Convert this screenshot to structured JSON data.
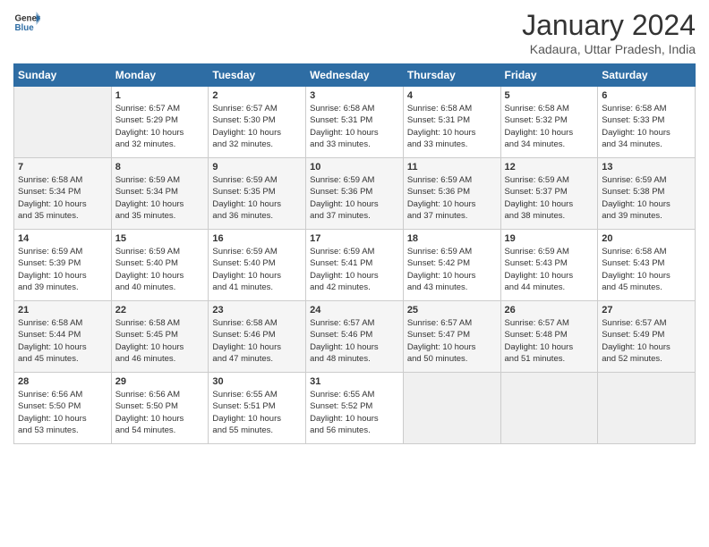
{
  "header": {
    "logo_line1": "General",
    "logo_line2": "Blue",
    "month_title": "January 2024",
    "location": "Kadaura, Uttar Pradesh, India"
  },
  "days_of_week": [
    "Sunday",
    "Monday",
    "Tuesday",
    "Wednesday",
    "Thursday",
    "Friday",
    "Saturday"
  ],
  "weeks": [
    [
      {
        "day": "",
        "empty": true
      },
      {
        "day": "1",
        "sunrise": "6:57 AM",
        "sunset": "5:29 PM",
        "daylight": "10 hours and 32 minutes."
      },
      {
        "day": "2",
        "sunrise": "6:57 AM",
        "sunset": "5:30 PM",
        "daylight": "10 hours and 32 minutes."
      },
      {
        "day": "3",
        "sunrise": "6:58 AM",
        "sunset": "5:31 PM",
        "daylight": "10 hours and 33 minutes."
      },
      {
        "day": "4",
        "sunrise": "6:58 AM",
        "sunset": "5:31 PM",
        "daylight": "10 hours and 33 minutes."
      },
      {
        "day": "5",
        "sunrise": "6:58 AM",
        "sunset": "5:32 PM",
        "daylight": "10 hours and 34 minutes."
      },
      {
        "day": "6",
        "sunrise": "6:58 AM",
        "sunset": "5:33 PM",
        "daylight": "10 hours and 34 minutes."
      }
    ],
    [
      {
        "day": "7",
        "sunrise": "6:58 AM",
        "sunset": "5:34 PM",
        "daylight": "10 hours and 35 minutes."
      },
      {
        "day": "8",
        "sunrise": "6:59 AM",
        "sunset": "5:34 PM",
        "daylight": "10 hours and 35 minutes."
      },
      {
        "day": "9",
        "sunrise": "6:59 AM",
        "sunset": "5:35 PM",
        "daylight": "10 hours and 36 minutes."
      },
      {
        "day": "10",
        "sunrise": "6:59 AM",
        "sunset": "5:36 PM",
        "daylight": "10 hours and 37 minutes."
      },
      {
        "day": "11",
        "sunrise": "6:59 AM",
        "sunset": "5:36 PM",
        "daylight": "10 hours and 37 minutes."
      },
      {
        "day": "12",
        "sunrise": "6:59 AM",
        "sunset": "5:37 PM",
        "daylight": "10 hours and 38 minutes."
      },
      {
        "day": "13",
        "sunrise": "6:59 AM",
        "sunset": "5:38 PM",
        "daylight": "10 hours and 39 minutes."
      }
    ],
    [
      {
        "day": "14",
        "sunrise": "6:59 AM",
        "sunset": "5:39 PM",
        "daylight": "10 hours and 39 minutes."
      },
      {
        "day": "15",
        "sunrise": "6:59 AM",
        "sunset": "5:40 PM",
        "daylight": "10 hours and 40 minutes."
      },
      {
        "day": "16",
        "sunrise": "6:59 AM",
        "sunset": "5:40 PM",
        "daylight": "10 hours and 41 minutes."
      },
      {
        "day": "17",
        "sunrise": "6:59 AM",
        "sunset": "5:41 PM",
        "daylight": "10 hours and 42 minutes."
      },
      {
        "day": "18",
        "sunrise": "6:59 AM",
        "sunset": "5:42 PM",
        "daylight": "10 hours and 43 minutes."
      },
      {
        "day": "19",
        "sunrise": "6:59 AM",
        "sunset": "5:43 PM",
        "daylight": "10 hours and 44 minutes."
      },
      {
        "day": "20",
        "sunrise": "6:58 AM",
        "sunset": "5:43 PM",
        "daylight": "10 hours and 45 minutes."
      }
    ],
    [
      {
        "day": "21",
        "sunrise": "6:58 AM",
        "sunset": "5:44 PM",
        "daylight": "10 hours and 45 minutes."
      },
      {
        "day": "22",
        "sunrise": "6:58 AM",
        "sunset": "5:45 PM",
        "daylight": "10 hours and 46 minutes."
      },
      {
        "day": "23",
        "sunrise": "6:58 AM",
        "sunset": "5:46 PM",
        "daylight": "10 hours and 47 minutes."
      },
      {
        "day": "24",
        "sunrise": "6:57 AM",
        "sunset": "5:46 PM",
        "daylight": "10 hours and 48 minutes."
      },
      {
        "day": "25",
        "sunrise": "6:57 AM",
        "sunset": "5:47 PM",
        "daylight": "10 hours and 50 minutes."
      },
      {
        "day": "26",
        "sunrise": "6:57 AM",
        "sunset": "5:48 PM",
        "daylight": "10 hours and 51 minutes."
      },
      {
        "day": "27",
        "sunrise": "6:57 AM",
        "sunset": "5:49 PM",
        "daylight": "10 hours and 52 minutes."
      }
    ],
    [
      {
        "day": "28",
        "sunrise": "6:56 AM",
        "sunset": "5:50 PM",
        "daylight": "10 hours and 53 minutes."
      },
      {
        "day": "29",
        "sunrise": "6:56 AM",
        "sunset": "5:50 PM",
        "daylight": "10 hours and 54 minutes."
      },
      {
        "day": "30",
        "sunrise": "6:55 AM",
        "sunset": "5:51 PM",
        "daylight": "10 hours and 55 minutes."
      },
      {
        "day": "31",
        "sunrise": "6:55 AM",
        "sunset": "5:52 PM",
        "daylight": "10 hours and 56 minutes."
      },
      {
        "day": "",
        "empty": true
      },
      {
        "day": "",
        "empty": true
      },
      {
        "day": "",
        "empty": true
      }
    ]
  ],
  "labels": {
    "sunrise_prefix": "Sunrise: ",
    "sunset_prefix": "Sunset: ",
    "daylight_prefix": "Daylight: "
  }
}
